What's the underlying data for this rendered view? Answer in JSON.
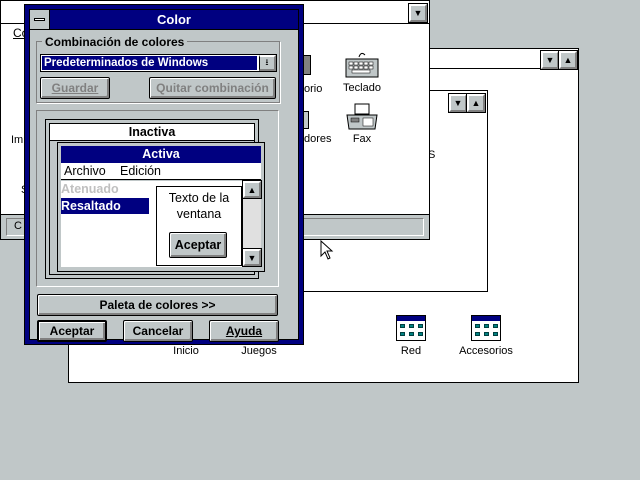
{
  "colors": {
    "desktop": "#c0c7c8",
    "title_active": "#000080",
    "highlight": "#000080",
    "disabled_text": "#c0c0c0"
  },
  "background_windows": {
    "control_panel": {
      "menu_fragment": "Co",
      "left_labels": [
        "Imp",
        "S"
      ],
      "icons": [
        {
          "name": "keyboard-icon",
          "label": "Teclado"
        },
        {
          "name": "fax-icon",
          "label": "Fax"
        }
      ],
      "partial_labels": [
        "orio",
        "dores"
      ]
    },
    "middle_window": {
      "partial_label": "S"
    },
    "program_manager": {
      "groups": [
        {
          "label": "Inicio"
        },
        {
          "label": "Juegos"
        },
        {
          "label": "Red"
        },
        {
          "label": "Accesorios"
        }
      ],
      "status_fragment": "C"
    }
  },
  "dialog": {
    "title": "Color",
    "scheme_group_label": "Combinación de colores",
    "scheme_value": "Predeterminados de Windows",
    "save_button": "Guardar",
    "remove_button": "Quitar combinación",
    "preview": {
      "inactive_title": "Inactiva",
      "active_title": "Activa",
      "menu_items": [
        "Archivo",
        "Edición"
      ],
      "disabled_item": "Atenuado",
      "highlighted_item": "Resaltado",
      "window_text": "Texto de la ventana",
      "ok_button": "Aceptar"
    },
    "palette_button": "Paleta de colores >>",
    "ok_button": "Aceptar",
    "cancel_button": "Cancelar",
    "help_button": "Ayuda"
  }
}
